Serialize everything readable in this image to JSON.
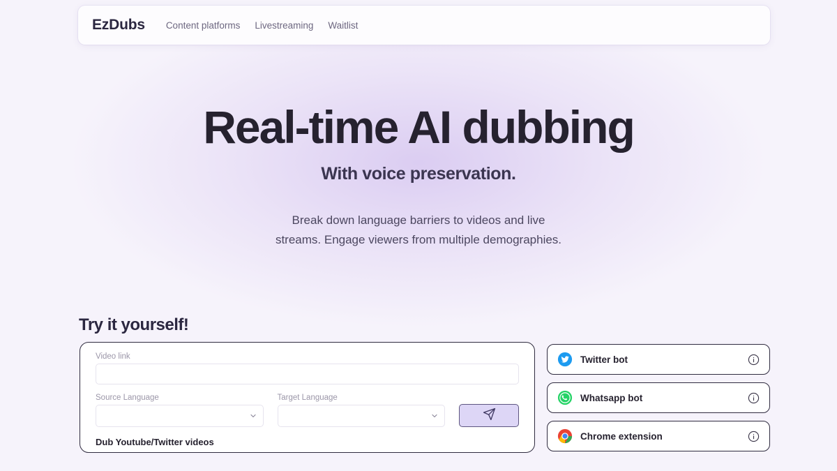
{
  "nav": {
    "logo": "EzDubs",
    "links": [
      {
        "label": "Content platforms",
        "icon": ""
      },
      {
        "label": "Livestreaming",
        "icon": ""
      },
      {
        "label": "Waitlist",
        "icon": ""
      }
    ]
  },
  "hero": {
    "title": "Real-time AI dubbing",
    "subtitle": "With voice preservation.",
    "description_line1": "Break down language barriers to videos and live",
    "description_line2": "streams. Engage viewers from multiple demographies."
  },
  "try_section": {
    "heading": "Try it yourself!",
    "video_link": {
      "label": "Video link",
      "value": "",
      "placeholder": ""
    },
    "source_language": {
      "label": "Source Language",
      "value": "",
      "options": [
        ""
      ]
    },
    "target_language": {
      "label": "Target Language",
      "value": "",
      "options": [
        ""
      ]
    },
    "send_button_icon": "paper-plane-icon",
    "note": "Dub Youtube/Twitter videos"
  },
  "side_cards": [
    {
      "label": "Twitter bot",
      "icon": "twitter-icon",
      "info_icon": "info-icon"
    },
    {
      "label": "Whatsapp bot",
      "icon": "whatsapp-icon",
      "info_icon": "info-icon"
    },
    {
      "label": "Chrome extension",
      "icon": "chrome-icon",
      "info_icon": "info-icon"
    }
  ],
  "colors": {
    "page_background": "#f6f3fb",
    "glow": "#d6c6f0",
    "text_dark": "#26222f",
    "text_muted": "#6d6780",
    "accent_button": "#ddd6f6",
    "border_dark": "#2f2b3f",
    "twitter_blue": "#1d9bf0",
    "whatsapp_green": "#25d366",
    "chrome_red": "#ea4335",
    "chrome_yellow": "#fbbc05",
    "chrome_green": "#34a853",
    "chrome_blue": "#4285f4"
  }
}
